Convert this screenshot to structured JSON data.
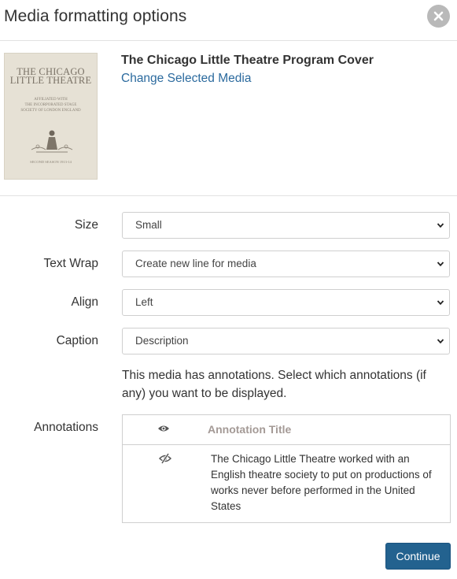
{
  "dialog": {
    "title": "Media formatting options",
    "close_icon": "close-icon"
  },
  "media": {
    "thumbnail": {
      "line1": "THE CHICAGO",
      "line2": "LITTLE THEATRE",
      "line3": "AFFILIATED WITH",
      "line4": "THE INCORPORATED STAGE",
      "line5": "SOCIETY OF LONDON ENGLAND",
      "line6": "SECOND SEASON 1913-14"
    },
    "title": "The Chicago Little Theatre Program Cover",
    "change_link": "Change Selected Media"
  },
  "form": {
    "size": {
      "label": "Size",
      "value": "Small"
    },
    "text_wrap": {
      "label": "Text Wrap",
      "value": "Create new line for media"
    },
    "align": {
      "label": "Align",
      "value": "Left"
    },
    "caption": {
      "label": "Caption",
      "value": "Description"
    }
  },
  "annotations": {
    "note": "This media has annotations. Select which annotations (if any) you want to be displayed.",
    "label": "Annotations",
    "header_icon": "eye-icon",
    "column_title": "Annotation Title",
    "rows": [
      {
        "icon": "eye-slash-icon",
        "text": "The Chicago Little Theatre worked with an English theatre society to put on productions of works never before performed in the United States"
      }
    ]
  },
  "footer": {
    "continue_label": "Continue"
  },
  "colors": {
    "accent": "#23628f",
    "link": "#2b6a9e",
    "muted_header": "#a49a96"
  }
}
